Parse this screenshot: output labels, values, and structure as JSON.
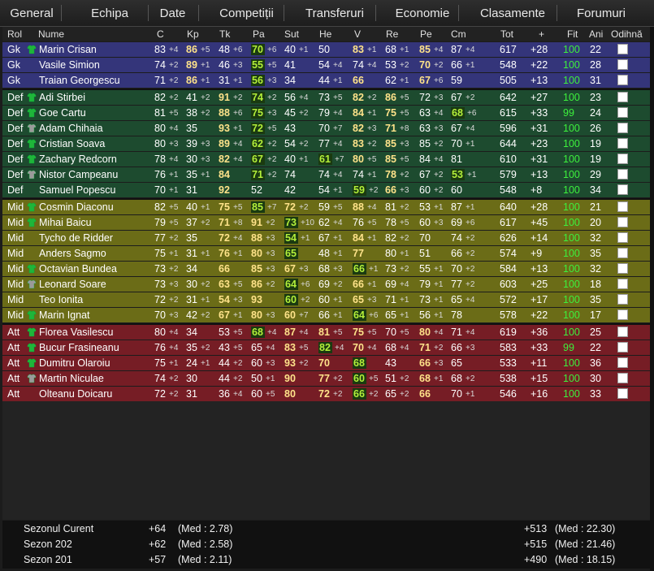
{
  "nav": [
    "General",
    "Echipa",
    "Date",
    "Competiții",
    "Transferuri",
    "Economie",
    "Clasamente",
    "Forumuri"
  ],
  "columns": [
    "Rol",
    "Nume",
    "C",
    "Kp",
    "Tk",
    "Pa",
    "Sut",
    "He",
    "V",
    "Re",
    "Pe",
    "Cm",
    "Tot",
    "+",
    "Fit",
    "Ani",
    "Odihnă"
  ],
  "players": [
    {
      "r": "Gk",
      "n": "Marin Crisan",
      "s": "green",
      "st": [
        [
          83,
          "+4"
        ],
        [
          86,
          "+5",
          1
        ],
        [
          48,
          "+6"
        ],
        [
          70,
          "+6",
          2
        ],
        [
          40,
          "+1"
        ],
        [
          50,
          ""
        ],
        [
          83,
          "+1",
          1
        ],
        [
          68,
          "+1"
        ],
        [
          85,
          "+4",
          1
        ],
        [
          87,
          "+4"
        ]
      ],
      "tot": 617,
      "p": "+28",
      "fit": 100,
      "ani": 22
    },
    {
      "r": "Gk",
      "n": "Vasile Simion",
      "s": "",
      "st": [
        [
          74,
          "+2"
        ],
        [
          89,
          "+1",
          1
        ],
        [
          46,
          "+3"
        ],
        [
          55,
          "+5",
          2
        ],
        [
          41,
          ""
        ],
        [
          54,
          "+4"
        ],
        [
          74,
          "+4"
        ],
        [
          53,
          "+2"
        ],
        [
          70,
          "+2",
          1
        ],
        [
          66,
          "+1"
        ]
      ],
      "tot": 548,
      "p": "+22",
      "fit": 100,
      "ani": 28
    },
    {
      "r": "Gk",
      "n": "Traian Georgescu",
      "s": "",
      "st": [
        [
          71,
          "+2"
        ],
        [
          86,
          "+1",
          1
        ],
        [
          31,
          "+1"
        ],
        [
          56,
          "+3",
          2
        ],
        [
          34,
          ""
        ],
        [
          44,
          "+1"
        ],
        [
          66,
          "",
          1
        ],
        [
          62,
          "+1"
        ],
        [
          67,
          "+6",
          1
        ],
        [
          59,
          ""
        ]
      ],
      "tot": 505,
      "p": "+13",
      "fit": 100,
      "ani": 31
    },
    {
      "r": "Def",
      "n": "Adi Stirbei",
      "s": "green",
      "st": [
        [
          82,
          "+2"
        ],
        [
          41,
          "+2"
        ],
        [
          91,
          "+2",
          1
        ],
        [
          74,
          "+2",
          2
        ],
        [
          56,
          "+4"
        ],
        [
          73,
          "+5"
        ],
        [
          82,
          "+2",
          1
        ],
        [
          86,
          "+5",
          1
        ],
        [
          72,
          "+3"
        ],
        [
          67,
          "+2"
        ]
      ],
      "tot": 642,
      "p": "+27",
      "fit": 100,
      "ani": 23
    },
    {
      "r": "Def",
      "n": "Goe Cartu",
      "s": "green",
      "st": [
        [
          81,
          "+5"
        ],
        [
          38,
          "+2"
        ],
        [
          88,
          "+6",
          1
        ],
        [
          75,
          "+3",
          2
        ],
        [
          45,
          "+2"
        ],
        [
          79,
          "+4"
        ],
        [
          84,
          "+1",
          1
        ],
        [
          75,
          "+5",
          1
        ],
        [
          63,
          "+4"
        ],
        [
          68,
          "+6",
          2
        ]
      ],
      "tot": 615,
      "p": "+33",
      "fit": 99,
      "ani": 24
    },
    {
      "r": "Def",
      "n": "Adam Chihaia",
      "s": "gray",
      "st": [
        [
          80,
          "+4"
        ],
        [
          35,
          ""
        ],
        [
          93,
          "+1",
          1
        ],
        [
          72,
          "+5",
          2
        ],
        [
          43,
          ""
        ],
        [
          70,
          "+7"
        ],
        [
          82,
          "+3",
          1
        ],
        [
          71,
          "+8",
          1
        ],
        [
          63,
          "+3"
        ],
        [
          67,
          "+4"
        ]
      ],
      "tot": 596,
      "p": "+31",
      "fit": 100,
      "ani": 26
    },
    {
      "r": "Def",
      "n": "Cristian Soava",
      "s": "green",
      "st": [
        [
          80,
          "+3"
        ],
        [
          39,
          "+3"
        ],
        [
          89,
          "+4",
          1
        ],
        [
          62,
          "+2",
          2
        ],
        [
          54,
          "+2"
        ],
        [
          77,
          "+4"
        ],
        [
          83,
          "+2",
          1
        ],
        [
          85,
          "+3",
          1
        ],
        [
          85,
          "+2"
        ],
        [
          70,
          "+1"
        ]
      ],
      "tot": 644,
      "p": "+23",
      "fit": 100,
      "ani": 19
    },
    {
      "r": "Def",
      "n": "Zachary Redcorn",
      "s": "green",
      "st": [
        [
          78,
          "+4"
        ],
        [
          30,
          "+3"
        ],
        [
          82,
          "+4",
          1
        ],
        [
          67,
          "+2",
          2
        ],
        [
          40,
          "+1"
        ],
        [
          61,
          "+7",
          2
        ],
        [
          80,
          "+5",
          1
        ],
        [
          85,
          "+5",
          1
        ],
        [
          84,
          "+4"
        ],
        [
          81,
          ""
        ]
      ],
      "tot": 610,
      "p": "+31",
      "fit": 100,
      "ani": 19
    },
    {
      "r": "Def",
      "n": "Nistor Campeanu",
      "s": "gray",
      "st": [
        [
          76,
          "+1"
        ],
        [
          35,
          "+1"
        ],
        [
          84,
          "",
          1
        ],
        [
          71,
          "+2",
          2
        ],
        [
          74,
          ""
        ],
        [
          74,
          "+4"
        ],
        [
          74,
          "+1"
        ],
        [
          78,
          "+2",
          1
        ],
        [
          67,
          "+2"
        ],
        [
          53,
          "+1",
          2
        ]
      ],
      "tot": 579,
      "p": "+13",
      "fit": 100,
      "ani": 29
    },
    {
      "r": "Def",
      "n": "Samuel Popescu",
      "s": "",
      "st": [
        [
          70,
          "+1"
        ],
        [
          31,
          ""
        ],
        [
          92,
          "",
          1
        ],
        [
          52,
          ""
        ],
        [
          42,
          ""
        ],
        [
          54,
          "+1"
        ],
        [
          59,
          "+2",
          2
        ],
        [
          66,
          "+3",
          1
        ],
        [
          60,
          "+2"
        ],
        [
          60,
          ""
        ]
      ],
      "tot": 548,
      "p": "+8",
      "fit": 100,
      "ani": 34
    },
    {
      "r": "Mid",
      "n": "Cosmin Diaconu",
      "s": "green",
      "st": [
        [
          82,
          "+5"
        ],
        [
          40,
          "+1"
        ],
        [
          75,
          "+5",
          1
        ],
        [
          85,
          "+7",
          2
        ],
        [
          72,
          "+2",
          1
        ],
        [
          59,
          "+5"
        ],
        [
          88,
          "+4",
          1
        ],
        [
          81,
          "+2"
        ],
        [
          53,
          "+1"
        ],
        [
          87,
          "+1"
        ]
      ],
      "tot": 640,
      "p": "+28",
      "fit": 100,
      "ani": 21
    },
    {
      "r": "Mid",
      "n": "Mihai Baicu",
      "s": "green",
      "st": [
        [
          79,
          "+5"
        ],
        [
          37,
          "+2"
        ],
        [
          71,
          "+8",
          1
        ],
        [
          91,
          "+2",
          1
        ],
        [
          73,
          "+10",
          2
        ],
        [
          62,
          "+4"
        ],
        [
          76,
          "+5"
        ],
        [
          78,
          "+5"
        ],
        [
          60,
          "+3"
        ],
        [
          69,
          "+6"
        ]
      ],
      "tot": 617,
      "p": "+45",
      "fit": 100,
      "ani": 20
    },
    {
      "r": "Mid",
      "n": "Tycho de Ridder",
      "s": "",
      "st": [
        [
          77,
          "+2"
        ],
        [
          35,
          ""
        ],
        [
          72,
          "+4",
          1
        ],
        [
          88,
          "+3",
          1
        ],
        [
          54,
          "+1",
          2
        ],
        [
          67,
          "+1"
        ],
        [
          84,
          "+1",
          1
        ],
        [
          82,
          "+2"
        ],
        [
          70,
          ""
        ],
        [
          74,
          "+2"
        ]
      ],
      "tot": 626,
      "p": "+14",
      "fit": 100,
      "ani": 32
    },
    {
      "r": "Mid",
      "n": "Anders Sagmo",
      "s": "",
      "st": [
        [
          75,
          "+1"
        ],
        [
          31,
          "+1"
        ],
        [
          76,
          "+1",
          1
        ],
        [
          80,
          "+3",
          1
        ],
        [
          65,
          "",
          2
        ],
        [
          48,
          "+1"
        ],
        [
          77,
          "",
          1
        ],
        [
          80,
          "+1"
        ],
        [
          51,
          ""
        ],
        [
          66,
          "+2"
        ]
      ],
      "tot": 574,
      "p": "+9",
      "fit": 100,
      "ani": 35
    },
    {
      "r": "Mid",
      "n": "Octavian Bundea",
      "s": "green",
      "st": [
        [
          73,
          "+2"
        ],
        [
          34,
          ""
        ],
        [
          66,
          "",
          1
        ],
        [
          85,
          "+3",
          1
        ],
        [
          67,
          "+3",
          1
        ],
        [
          68,
          "+3"
        ],
        [
          66,
          "+1",
          2
        ],
        [
          73,
          "+2"
        ],
        [
          55,
          "+1"
        ],
        [
          70,
          "+2"
        ]
      ],
      "tot": 584,
      "p": "+13",
      "fit": 100,
      "ani": 32
    },
    {
      "r": "Mid",
      "n": "Leonard Soare",
      "s": "gray",
      "st": [
        [
          73,
          "+3"
        ],
        [
          30,
          "+2"
        ],
        [
          63,
          "+5",
          1
        ],
        [
          86,
          "+2",
          1
        ],
        [
          64,
          "+6",
          2
        ],
        [
          69,
          "+2"
        ],
        [
          66,
          "+1",
          1
        ],
        [
          69,
          "+4"
        ],
        [
          79,
          "+1"
        ],
        [
          77,
          "+2"
        ]
      ],
      "tot": 603,
      "p": "+25",
      "fit": 100,
      "ani": 18
    },
    {
      "r": "Mid",
      "n": "Teo Ionita",
      "s": "",
      "st": [
        [
          72,
          "+2"
        ],
        [
          31,
          "+1"
        ],
        [
          54,
          "+3",
          1
        ],
        [
          93,
          "",
          1
        ],
        [
          60,
          "+2",
          2
        ],
        [
          60,
          "+1"
        ],
        [
          65,
          "+3",
          1
        ],
        [
          71,
          "+1"
        ],
        [
          73,
          "+1"
        ],
        [
          65,
          "+4"
        ]
      ],
      "tot": 572,
      "p": "+17",
      "fit": 100,
      "ani": 35
    },
    {
      "r": "Mid",
      "n": "Marin Ignat",
      "s": "green",
      "st": [
        [
          70,
          "+3"
        ],
        [
          42,
          "+2"
        ],
        [
          67,
          "+1",
          1
        ],
        [
          80,
          "+3",
          1
        ],
        [
          60,
          "+7",
          1
        ],
        [
          66,
          "+1"
        ],
        [
          64,
          "+6",
          2
        ],
        [
          65,
          "+1"
        ],
        [
          56,
          "+1"
        ],
        [
          78,
          ""
        ]
      ],
      "tot": 578,
      "p": "+22",
      "fit": 100,
      "ani": 17
    },
    {
      "r": "Att",
      "n": "Florea Vasilescu",
      "s": "green",
      "st": [
        [
          80,
          "+4"
        ],
        [
          34,
          ""
        ],
        [
          53,
          "+5"
        ],
        [
          68,
          "+4",
          2
        ],
        [
          87,
          "+4",
          1
        ],
        [
          81,
          "+5",
          1
        ],
        [
          75,
          "+5",
          1
        ],
        [
          70,
          "+5"
        ],
        [
          80,
          "+4",
          1
        ],
        [
          71,
          "+4"
        ]
      ],
      "tot": 619,
      "p": "+36",
      "fit": 100,
      "ani": 25
    },
    {
      "r": "Att",
      "n": "Bucur Frasineanu",
      "s": "green",
      "st": [
        [
          76,
          "+4"
        ],
        [
          35,
          "+2"
        ],
        [
          43,
          "+5"
        ],
        [
          65,
          "+4"
        ],
        [
          83,
          "+5",
          1
        ],
        [
          82,
          "+4",
          2
        ],
        [
          70,
          "+4",
          1
        ],
        [
          68,
          "+4"
        ],
        [
          71,
          "+2",
          1
        ],
        [
          66,
          "+3"
        ]
      ],
      "tot": 583,
      "p": "+33",
      "fit": 99,
      "ani": 22
    },
    {
      "r": "Att",
      "n": "Dumitru Olaroiu",
      "s": "green",
      "st": [
        [
          75,
          "+1"
        ],
        [
          24,
          "+1"
        ],
        [
          44,
          "+2"
        ],
        [
          60,
          "+3"
        ],
        [
          93,
          "+2",
          1
        ],
        [
          70,
          "",
          1
        ],
        [
          68,
          "",
          2
        ],
        [
          43,
          ""
        ],
        [
          66,
          "+3",
          1
        ],
        [
          65,
          ""
        ]
      ],
      "tot": 533,
      "p": "+11",
      "fit": 100,
      "ani": 36
    },
    {
      "r": "Att",
      "n": "Martin Niculae",
      "s": "gray",
      "st": [
        [
          74,
          "+2"
        ],
        [
          30,
          ""
        ],
        [
          44,
          "+2"
        ],
        [
          50,
          "+1"
        ],
        [
          90,
          "",
          1
        ],
        [
          77,
          "+2",
          1
        ],
        [
          60,
          "+5",
          2
        ],
        [
          51,
          "+2"
        ],
        [
          68,
          "+1",
          1
        ],
        [
          68,
          "+2"
        ]
      ],
      "tot": 538,
      "p": "+15",
      "fit": 100,
      "ani": 30
    },
    {
      "r": "Att",
      "n": "Olteanu Doicaru",
      "s": "",
      "st": [
        [
          72,
          "+2"
        ],
        [
          31,
          ""
        ],
        [
          36,
          "+4"
        ],
        [
          60,
          "+5"
        ],
        [
          80,
          "",
          1
        ],
        [
          72,
          "+2",
          1
        ],
        [
          66,
          "+2",
          2
        ],
        [
          65,
          "+2"
        ],
        [
          66,
          "",
          1
        ],
        [
          70,
          "+1"
        ]
      ],
      "tot": 546,
      "p": "+16",
      "fit": 100,
      "ani": 33
    }
  ],
  "summary": [
    {
      "label": "Sezonul Curent",
      "a": "+64",
      "am": "(Med : 2.78)",
      "b": "+513",
      "bm": "(Med : 22.30)"
    },
    {
      "label": "Sezon 202",
      "a": "+62",
      "am": "(Med : 2.58)",
      "b": "+515",
      "bm": "(Med : 21.46)"
    },
    {
      "label": "Sezon 201",
      "a": "+57",
      "am": "(Med : 2.11)",
      "b": "+490",
      "bm": "(Med : 18.15)"
    }
  ],
  "colors": {
    "gk": "#34357a",
    "def": "#1d4b2f",
    "mid": "#6b6c17",
    "att": "#761d25",
    "fit": "#3df03d",
    "highlight": "#ffe38a",
    "box": "#b4f03a"
  }
}
